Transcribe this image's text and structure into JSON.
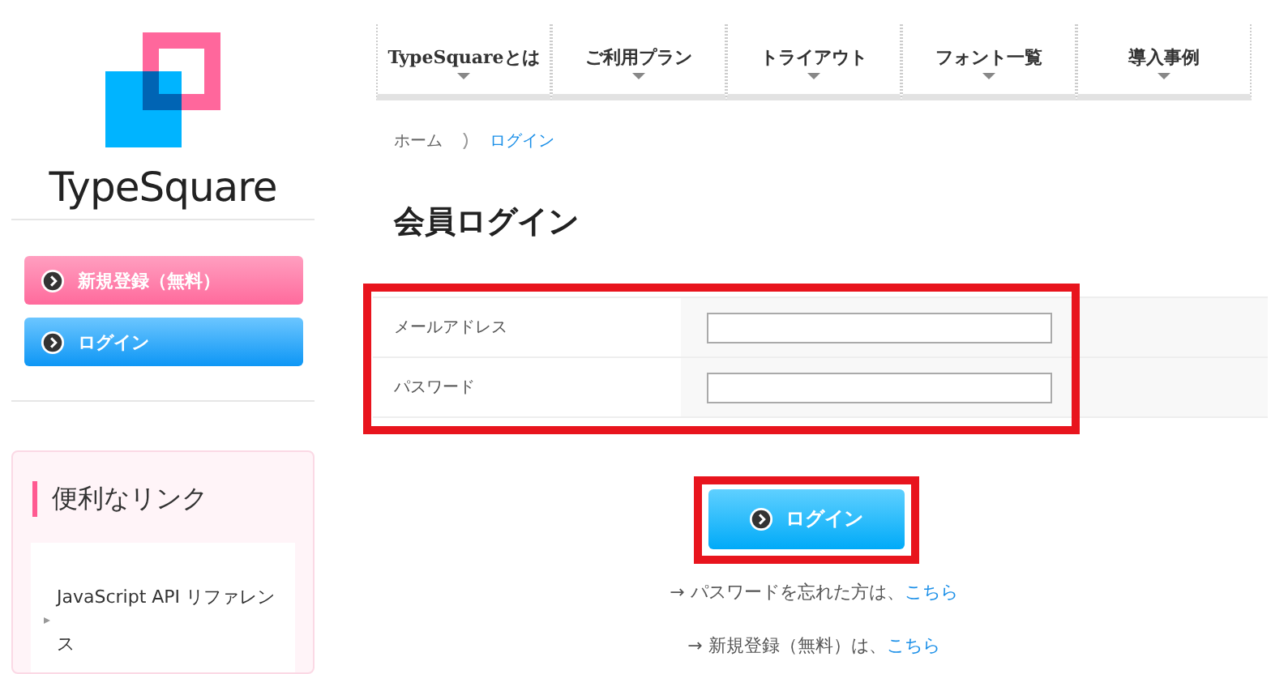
{
  "logo": {
    "text": "TypeSquare"
  },
  "sidebar": {
    "buttons": [
      {
        "kind": "signup",
        "label": "新規登録（無料）"
      },
      {
        "kind": "login",
        "label": "ログイン"
      }
    ],
    "links_panel": {
      "title": "便利なリンク",
      "items": [
        "JavaScript API リファレンス"
      ]
    }
  },
  "nav": [
    "TypeSquareとは",
    "ご利用プラン",
    "トライアウト",
    "フォント一覧",
    "導入事例"
  ],
  "breadcrumb": [
    {
      "label": "ホーム",
      "link": false
    },
    {
      "label": "ログイン",
      "link": true
    }
  ],
  "heading": "会員ログイン",
  "form": {
    "highlighted": true,
    "fields": [
      {
        "label": "メールアドレス"
      },
      {
        "label": "パスワード"
      }
    ]
  },
  "login_button": {
    "label": "ログイン",
    "highlighted": true
  },
  "help_links": [
    {
      "text": "→ パスワードを忘れた方は、",
      "link": "こちら"
    },
    {
      "text": "→ 新規登録（無料）は、",
      "link": "こちら"
    }
  ]
}
